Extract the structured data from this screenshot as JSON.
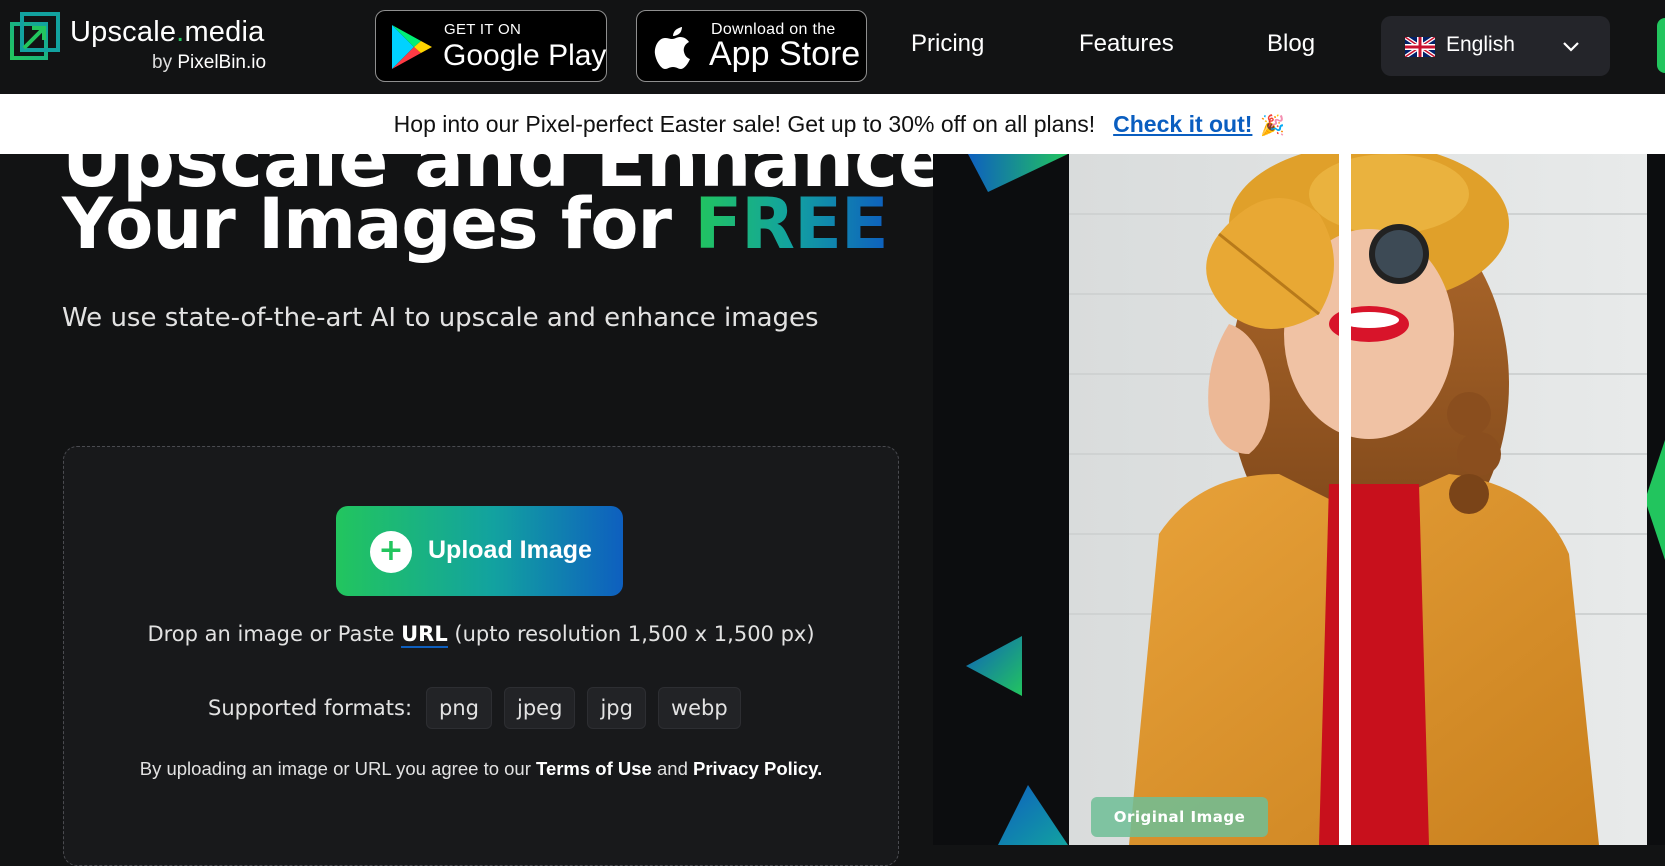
{
  "logo": {
    "title_main": "Upscale",
    "title_dot": ".",
    "title_tail": "media",
    "sub_prefix": "by ",
    "sub_brand": "PixelBin.io"
  },
  "stores": {
    "google_small": "GET IT ON",
    "google_big": "Google Play",
    "apple_small": "Download on the",
    "apple_big": "App Store"
  },
  "nav": {
    "pricing": "Pricing",
    "features": "Features",
    "blog": "Blog"
  },
  "language": {
    "selected": "English"
  },
  "banner": {
    "text": "Hop into our Pixel-perfect Easter sale! Get up to 30% off on all plans!",
    "link": "Check it out!",
    "emoji": "🎉"
  },
  "hero": {
    "line1": "Upscale and Enhance",
    "line2_prefix": "Your Images for ",
    "line2_highlight": "FREE",
    "subtitle": "We use state-of-the-art AI to upscale and enhance images"
  },
  "upload": {
    "button_label": "Upload Image",
    "plus": "+",
    "drop_prefix": "Drop an image or Paste ",
    "drop_link": "URL",
    "drop_suffix": " (upto resolution 1,500 x 1,500 px)",
    "formats_label": "Supported formats:",
    "formats": [
      "png",
      "jpeg",
      "jpg",
      "webp"
    ],
    "terms_prefix": "By uploading an image or URL you agree to our ",
    "terms_link": "Terms of Use",
    "terms_mid": " and ",
    "privacy_link": "Privacy Policy."
  },
  "showcase": {
    "badge": "Original Image"
  },
  "colors": {
    "background": "#121314",
    "accent_green": "#22c55e",
    "accent_blue": "#0e5fbf",
    "banner_link": "#0a5ec0"
  }
}
